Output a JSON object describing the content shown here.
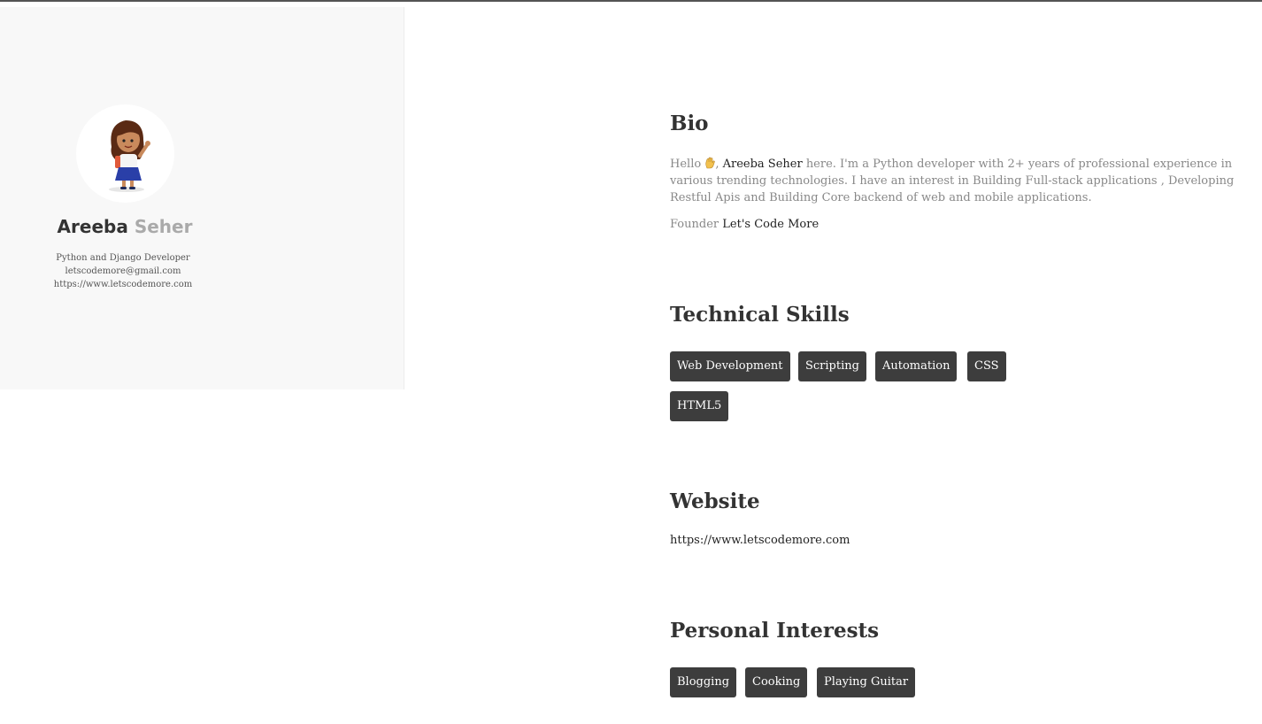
{
  "profile": {
    "first_name": "Areeba",
    "last_name": "Seher",
    "role": "Python and Django Developer",
    "email": "letscodemore@gmail.com",
    "url": "https://www.letscodemore.com",
    "avatar_icon": "girl-waving-avatar"
  },
  "bio": {
    "heading": "Bio",
    "greeting": "Hello",
    "wave_icon": "waving-hand-icon",
    "name": "Areeba Seher",
    "text": "here. I'm a Python developer with 2+ years of professional experience in various trending technologies. I have an interest in Building Full-stack applications , Developing Restful Apis and Building Core backend of web and mobile applications.",
    "founder_label": "Founder",
    "founder_company": "Let's Code More"
  },
  "skills": {
    "heading": "Technical Skills",
    "items": [
      "Web Development",
      "Scripting",
      "Automation",
      "CSS",
      "HTML5"
    ]
  },
  "website": {
    "heading": "Website",
    "url": "https://www.letscodemore.com"
  },
  "interests": {
    "heading": "Personal Interests",
    "items": [
      "Blogging",
      "Cooking",
      "Playing Guitar"
    ]
  },
  "colors": {
    "tag_bg": "#3d3d3d",
    "sidebar_bg": "#f8f8f8",
    "muted_text": "#888888"
  }
}
